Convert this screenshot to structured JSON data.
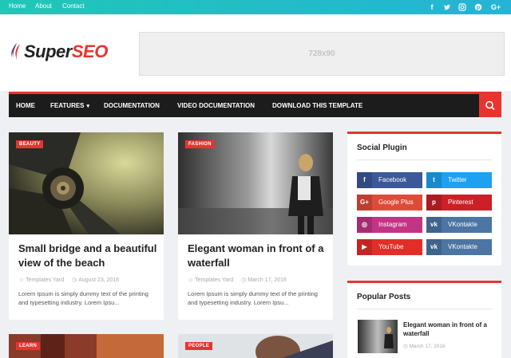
{
  "topbar": {
    "links": [
      "Home",
      "About",
      "Contact"
    ],
    "social_icons": [
      "facebook-icon",
      "twitter-icon",
      "instagram-icon",
      "pinterest-icon",
      "google-plus-icon"
    ],
    "gradient": [
      "#1fc7b6",
      "#26b3d6"
    ]
  },
  "header": {
    "logo_part1": "Super",
    "logo_part2": "SEO",
    "ad_text": "728x90"
  },
  "nav": {
    "items": [
      "HOME",
      "FEATURES",
      "DOCUMENTATION",
      "VIDEO DOCUMENTATION",
      "DOWNLOAD THIS TEMPLATE"
    ],
    "features_caret": "▾",
    "accent": "#e8342f"
  },
  "posts": [
    {
      "label": "BEAUTY",
      "title": "Small bridge and a beautiful view of the beach",
      "author": "Templates Yard",
      "date": "August 23, 2016",
      "excerpt": "Lorem Ipsum is simply dummy text of the printing and typesetting industry. Lorem Ipsu..."
    },
    {
      "label": "FASHION",
      "title": "Elegant woman in front of a waterfall",
      "author": "Templates Yard",
      "date": "March 17, 2016",
      "excerpt": "Lorem Ipsum is simply dummy text of the printing and typesetting industry. Lorem Ipsu..."
    },
    {
      "label": "LEARN"
    },
    {
      "label": "PEOPLE"
    }
  ],
  "sidebar": {
    "social_title": "Social Plugin",
    "social_buttons": [
      {
        "label": "Facebook",
        "icon": "facebook-icon",
        "color": "#3b5998",
        "glyph": "f"
      },
      {
        "label": "Twitter",
        "icon": "twitter-icon",
        "color": "#1da1f2",
        "glyph": "t"
      },
      {
        "label": "Google Plus",
        "icon": "google-plus-icon",
        "color": "#dd4b39",
        "glyph": "G+"
      },
      {
        "label": "Pinterest",
        "icon": "pinterest-icon",
        "color": "#cb2027",
        "glyph": "p"
      },
      {
        "label": "Instagram",
        "icon": "instagram-icon",
        "color": "#c13584",
        "glyph": "◎"
      },
      {
        "label": "VKontakte",
        "icon": "vk-icon",
        "color": "#4c75a3",
        "glyph": "vk"
      },
      {
        "label": "YouTube",
        "icon": "youtube-icon",
        "color": "#e52d27",
        "glyph": "▶"
      },
      {
        "label": "VKontakte",
        "icon": "vk-icon",
        "color": "#4c75a3",
        "glyph": "vk"
      }
    ],
    "popular_title": "Popular Posts",
    "popular": [
      {
        "title": "Elegant woman in front of a waterfall",
        "date": "March 17, 2016"
      }
    ]
  }
}
